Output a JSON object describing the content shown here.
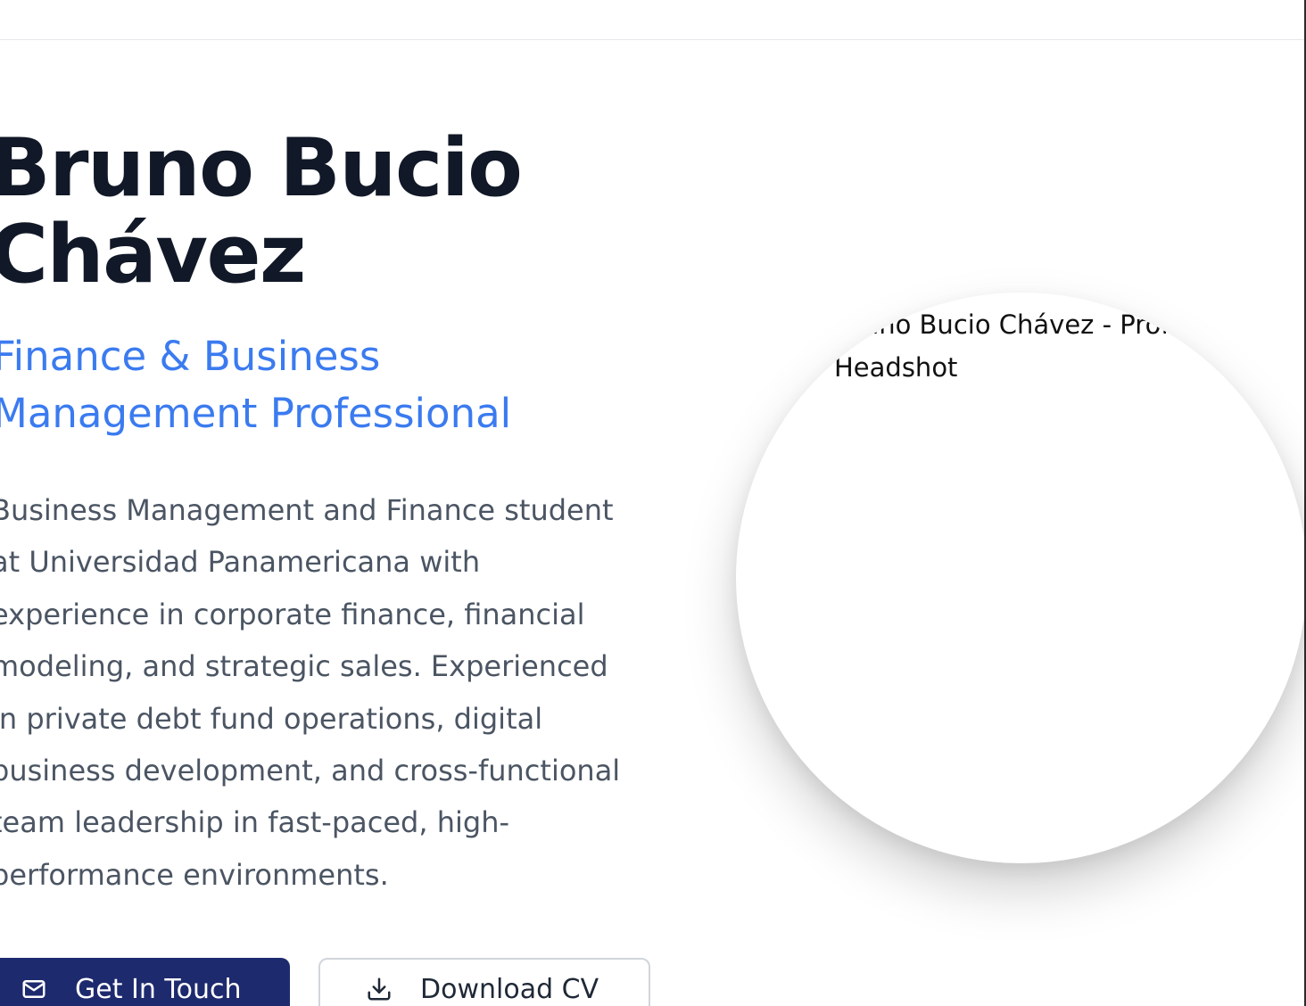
{
  "hero": {
    "name_line1": "Bruno Bucio",
    "name_line2": "Chávez",
    "subtitle_line1": "Finance & Business",
    "subtitle_line2": "Management Professional",
    "bio_lines": [
      "Business Management and Finance student",
      "at Universidad Panamericana with",
      "experience in corporate finance, financial",
      "modeling, and strategic sales. Experienced",
      "in private debt fund operations, digital",
      "business development, and cross-functional",
      "team leadership in fast-paced, high-",
      "performance environments."
    ],
    "primary_button": {
      "label": "Get In Touch",
      "icon": "mail-icon"
    },
    "secondary_button": {
      "label": "Download CV",
      "icon": "download-icon"
    }
  },
  "avatar": {
    "alt_text": "Bruno Bucio Chávez - Professional Headshot"
  },
  "colors": {
    "heading": "#111827",
    "accent": "#3b7bf0",
    "body_text": "#4b5563",
    "primary_button_bg": "#1e2a6e",
    "border": "#d1d5db"
  }
}
